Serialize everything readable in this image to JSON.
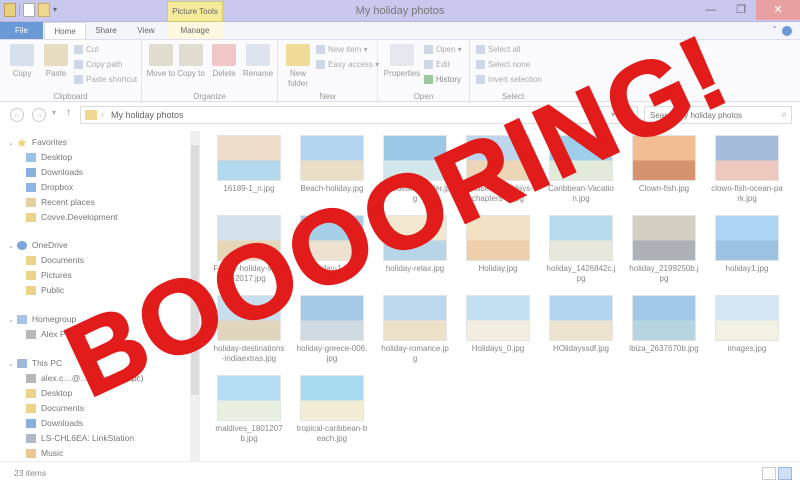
{
  "window": {
    "title": "My holiday photos",
    "context_tab": "Picture Tools",
    "controls": [
      "—",
      "❐",
      "✕"
    ]
  },
  "tabs": [
    {
      "label": "File"
    },
    {
      "label": "Home"
    },
    {
      "label": "Share"
    },
    {
      "label": "View"
    },
    {
      "label": "Manage"
    }
  ],
  "ribbon": {
    "clipboard": {
      "label": "Clipboard",
      "copy": "Copy",
      "paste": "Paste",
      "cut": "Cut",
      "copy_path": "Copy path",
      "paste_shortcut": "Paste shortcut"
    },
    "organize": {
      "label": "Organize",
      "move_to": "Move to",
      "copy_to": "Copy to",
      "delete": "Delete",
      "rename": "Rename"
    },
    "new": {
      "label": "New",
      "new_folder": "New folder",
      "new_item": "New item",
      "easy_access": "Easy access"
    },
    "open": {
      "label": "Open",
      "properties": "Properties",
      "open": "Open",
      "edit": "Edit",
      "history": "History"
    },
    "select": {
      "label": "Select",
      "select_all": "Select all",
      "select_none": "Select none",
      "invert_selection": "Invert selection"
    }
  },
  "address": {
    "path": "My holiday photos",
    "search_placeholder": "Search My holiday photos"
  },
  "nav": {
    "favorites": "Favorites",
    "desktop": "Desktop",
    "downloads": "Downloads",
    "dropbox": "Dropbox",
    "recent": "Recent places",
    "covve": "Covve.Development",
    "onedrive": "OneDrive",
    "documents": "Documents",
    "pictures": "Pictures",
    "public": "Public",
    "homegroup": "Homegroup",
    "alex_potoge": "Alex Potoge",
    "thispc": "This PC",
    "alex_account": "alex.c…@…il.com (alexpc)",
    "pc_desktop": "Desktop",
    "pc_documents": "Documents",
    "pc_downloads": "Downloads",
    "linkstation": "LS-CHL6EA: LinkStation",
    "music": "Music"
  },
  "files": [
    {
      "name": "16189-1_n.jpg",
      "c1": "#e8d2b8",
      "c2": "#9ccbe8"
    },
    {
      "name": "Beach-holiday.jpg",
      "c1": "#9cc8ea",
      "c2": "#e4d4b4"
    },
    {
      "name": "caribbean-header.jpg",
      "c1": "#7ab6e0",
      "c2": "#c4e0e4"
    },
    {
      "name": "caribbean-holidays-chapters-vi.jpg",
      "c1": "#a8c8e8",
      "c2": "#e8c8a0"
    },
    {
      "name": "Caribbean-Vacation.jpg",
      "c1": "#7ec0e4",
      "c2": "#d8e4d0"
    },
    {
      "name": "Clown-fish.jpg",
      "c1": "#f0a870",
      "c2": "#c87040"
    },
    {
      "name": "clown-fish-ocean-park.jpg",
      "c1": "#88a8d0",
      "c2": "#e8b8a8"
    },
    {
      "name": "Family-holiday-spec-2017.jpg",
      "c1": "#c8d8e8",
      "c2": "#e0c8a0"
    },
    {
      "name": "holiday-1.jpg",
      "c1": "#88c0e0",
      "c2": "#e8d8c0"
    },
    {
      "name": "holiday-relax.jpg",
      "c1": "#f0e0c0",
      "c2": "#a0c8e0"
    },
    {
      "name": "Holiday.jpg",
      "c1": "#f0d8b0",
      "c2": "#e8c090"
    },
    {
      "name": "holiday_1426842c.jpg",
      "c1": "#a0d0e8",
      "c2": "#e0e0d0"
    },
    {
      "name": "holiday_2199250b.jpg",
      "c1": "#c8c0b0",
      "c2": "#9098a0"
    },
    {
      "name": "holiday1.jpg",
      "c1": "#90c8f0",
      "c2": "#7ab0d8"
    },
    {
      "name": "holiday-destinations-indiaextras.jpg",
      "c1": "#b8d4e8",
      "c2": "#d8c8a8"
    },
    {
      "name": "holiday-greece-006.jpg",
      "c1": "#88b8e0",
      "c2": "#c0d0d8"
    },
    {
      "name": "holiday-romance.jpg",
      "c1": "#a8cce8",
      "c2": "#e8d8b8"
    },
    {
      "name": "Holidays_0.jpg",
      "c1": "#b0d8f0",
      "c2": "#f0e8d8"
    },
    {
      "name": "HOlidayssdf.jpg",
      "c1": "#9cc8ec",
      "c2": "#e8dcc0"
    },
    {
      "name": "ibiza_2637670b.jpg",
      "c1": "#80b8e0",
      "c2": "#a0c8d8"
    },
    {
      "name": "images.jpg",
      "c1": "#c8e0f0",
      "c2": "#f0ecdc"
    },
    {
      "name": "maldives_1801207b.jpg",
      "c1": "#9cd4f0",
      "c2": "#e0ecd8"
    },
    {
      "name": "tropical-caribbean-beach.jpg",
      "c1": "#8cd0ec",
      "c2": "#f0e8c8"
    }
  ],
  "status": {
    "count": "23 items"
  },
  "overlay": {
    "text": "BOOOORING!",
    "color": "#e21b1b"
  }
}
